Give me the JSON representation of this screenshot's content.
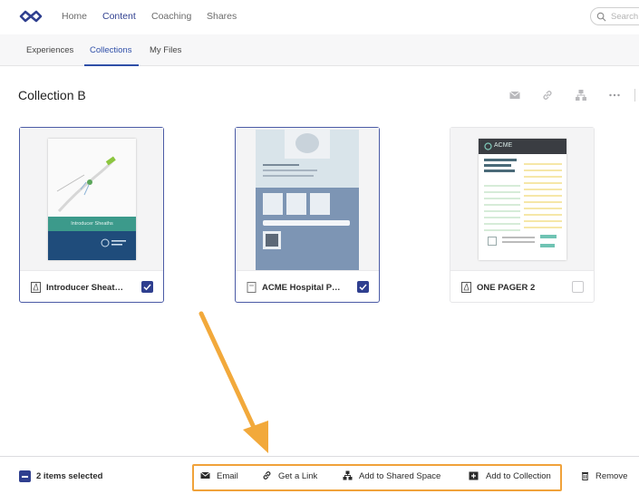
{
  "topnav": {
    "items": [
      {
        "label": "Home",
        "active": false
      },
      {
        "label": "Content",
        "active": true
      },
      {
        "label": "Coaching",
        "active": false
      },
      {
        "label": "Shares",
        "active": false
      }
    ],
    "search_placeholder": "Search"
  },
  "subnav": {
    "items": [
      {
        "label": "Experiences",
        "active": false
      },
      {
        "label": "Collections",
        "active": true
      },
      {
        "label": "My Files",
        "active": false
      }
    ]
  },
  "page": {
    "title": "Collection B",
    "tools": [
      "email-icon",
      "link-icon",
      "shared-space-icon",
      "more-icon"
    ]
  },
  "cards": [
    {
      "name": "Introducer Sheat…",
      "type_icon": "pdf-icon",
      "selected": true,
      "thumbnail": {
        "banner_text": "Introducer Sheaths",
        "colors": {
          "teal": "#3c9a8b",
          "navy": "#1f4c7b"
        }
      }
    },
    {
      "name": "ACME Hospital P…",
      "type_icon": "document-icon",
      "selected": true
    },
    {
      "name": "ONE PAGER 2",
      "type_icon": "pdf-icon",
      "selected": false,
      "thumbnail": {
        "logo_text": "ACME"
      }
    }
  ],
  "actionbar": {
    "selected_text": "2 items selected",
    "actions": [
      {
        "label": "Email",
        "icon": "envelope-icon"
      },
      {
        "label": "Get a Link",
        "icon": "link-icon"
      },
      {
        "label": "Add to Shared Space",
        "icon": "shared-space-icon"
      },
      {
        "label": "Add to Collection",
        "icon": "add-to-collection-icon"
      }
    ],
    "remove_label": "Remove",
    "highlight_color": "#f0a23a"
  },
  "colors": {
    "accent": "#2f3f8f",
    "annotation": "#f2a93b"
  }
}
